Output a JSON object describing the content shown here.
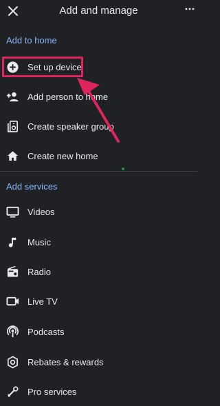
{
  "header": {
    "title": "Add and manage"
  },
  "sections": [
    {
      "label": "Add to home",
      "items": [
        {
          "label": "Set up device",
          "icon": "add-circle-icon"
        },
        {
          "label": "Add person to home",
          "icon": "add-person-icon"
        },
        {
          "label": "Create speaker group",
          "icon": "speaker-group-icon"
        },
        {
          "label": "Create new home",
          "icon": "home-icon"
        }
      ]
    },
    {
      "label": "Add services",
      "items": [
        {
          "label": "Videos",
          "icon": "monitor-icon"
        },
        {
          "label": "Music",
          "icon": "music-note-icon"
        },
        {
          "label": "Radio",
          "icon": "radio-icon"
        },
        {
          "label": "Live TV",
          "icon": "live-tv-icon"
        },
        {
          "label": "Podcasts",
          "icon": "podcast-icon"
        },
        {
          "label": "Rebates & rewards",
          "icon": "rebates-icon"
        },
        {
          "label": "Pro services",
          "icon": "pro-services-icon"
        }
      ]
    }
  ],
  "colors": {
    "background": "#202124",
    "accent": "#8ab4f8",
    "highlight": "#e0245e"
  }
}
